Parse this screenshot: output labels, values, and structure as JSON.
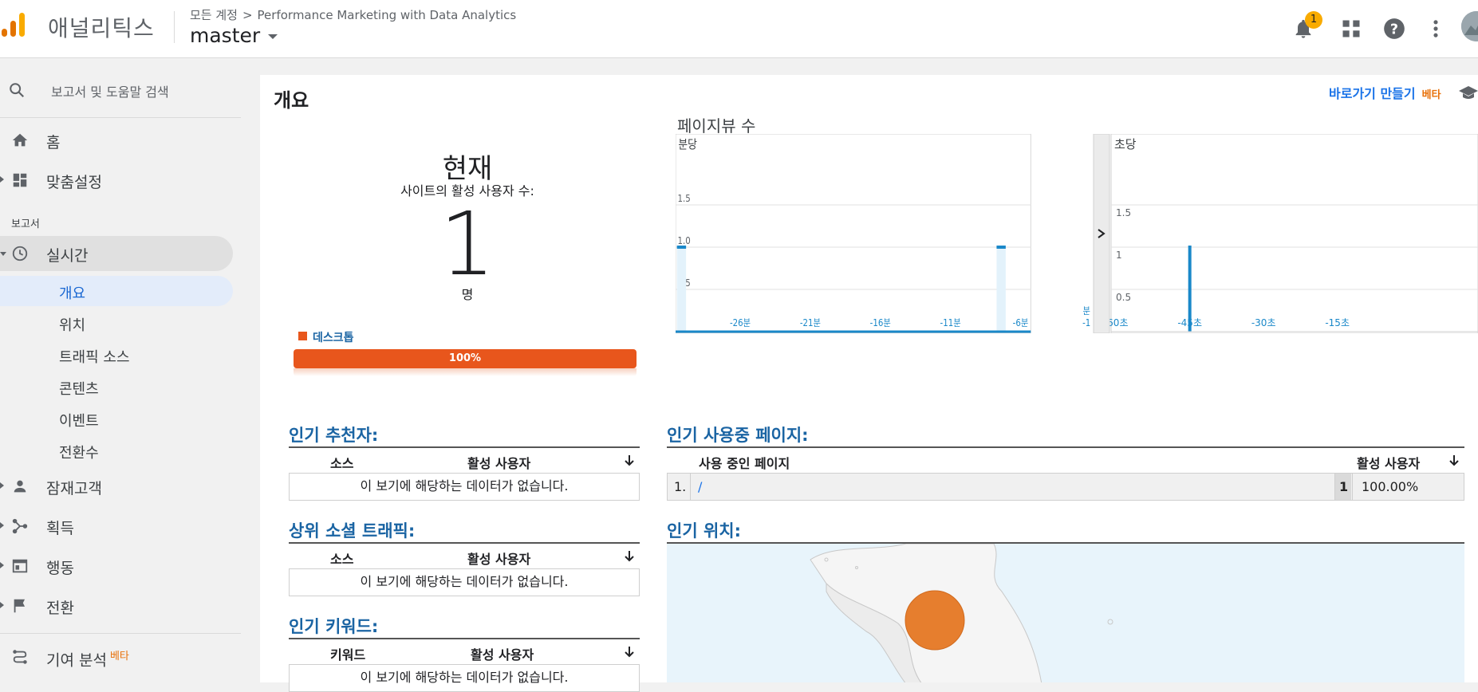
{
  "header": {
    "app_name": "애널리틱스",
    "breadcrumb_root": "모든 계정",
    "breadcrumb_sep": ">",
    "breadcrumb_property": "Performance Marketing with Data Analytics",
    "account_view": "master",
    "notification_count": "1"
  },
  "sidebar": {
    "search_placeholder": "보고서 및 도움말 검색",
    "home": "홈",
    "customization": "맞춤설정",
    "reports_section": "보고서",
    "realtime": "실시간",
    "realtime_sub": {
      "overview": "개요",
      "locations": "위치",
      "traffic_sources": "트래픽 소스",
      "content": "콘텐츠",
      "events": "이벤트",
      "conversions": "전환수"
    },
    "audience": "잠재고객",
    "acquisition": "획득",
    "behavior": "행동",
    "conversions": "전환",
    "attribution": "기여 분석",
    "attribution_badge": "베타"
  },
  "main": {
    "page_title": "개요",
    "shortcut_label": "바로가기 만들기",
    "shortcut_badge": "베타",
    "now_label": "현재",
    "active_users_label": "사이트의 활성 사용자 수:",
    "active_users_count": "1",
    "unit": "명",
    "device_legend": "데스크톱",
    "device_percent": "100%",
    "device_share": 1.0,
    "pageviews_title": "페이지뷰 수"
  },
  "chart_data": {
    "type": "bar",
    "title": "페이지뷰 수",
    "panels": [
      {
        "name": "분당",
        "x": [
          "-30",
          "-29",
          "-28",
          "-27",
          "-26",
          "-25",
          "-24",
          "-23",
          "-22",
          "-21",
          "-20",
          "-19",
          "-18",
          "-17",
          "-16",
          "-15",
          "-14",
          "-13",
          "-12",
          "-11",
          "-10",
          "-9",
          "-8",
          "-7",
          "-6",
          "-5",
          "-4",
          "-3",
          "-2",
          "-1"
        ],
        "values": [
          1,
          0,
          0,
          0,
          0,
          0,
          0,
          0,
          0,
          0,
          0,
          0,
          0,
          0,
          0,
          0,
          0,
          0,
          0,
          0,
          0,
          0,
          0,
          0,
          0,
          0,
          0,
          1,
          0,
          0
        ],
        "tick_labels": [
          "-26분",
          "-21분",
          "-16분",
          "-11분",
          "-6분",
          "분",
          "-1"
        ],
        "y_ticks": [
          "0.5",
          "1.0",
          "1.5"
        ],
        "ylim": [
          0,
          2
        ]
      },
      {
        "name": "초당",
        "x": [
          -60,
          -59,
          -58,
          -57,
          -56,
          -55,
          -54,
          -53,
          -52,
          -51,
          -50,
          -49,
          -48,
          -47,
          -46,
          -45,
          -44,
          -43,
          -42,
          -41,
          -40,
          -39,
          -38,
          -37,
          -36,
          -35,
          -34,
          -33,
          -32,
          -31,
          -30,
          -29,
          -28,
          -27,
          -26,
          -25,
          -24,
          -23,
          -22,
          -21,
          -20,
          -19,
          -18,
          -17,
          -16,
          -15,
          -14,
          -13,
          -12,
          -11,
          -10,
          -9,
          -8,
          -7,
          -6,
          -5,
          -4,
          -3,
          -2,
          -1
        ],
        "values": [
          0,
          0,
          0,
          0,
          0,
          0,
          0,
          0,
          0,
          0,
          0,
          0,
          0,
          0,
          0,
          1,
          0,
          0,
          0,
          0,
          0,
          0,
          0,
          0,
          0,
          0,
          0,
          0,
          0,
          0,
          0,
          0,
          0,
          0,
          0,
          0,
          0,
          0,
          0,
          0,
          0,
          0,
          0,
          0,
          0,
          0,
          0,
          0,
          0,
          0,
          0,
          0,
          0,
          0,
          0,
          0,
          0,
          0,
          0,
          0
        ],
        "tick_labels": [
          "-60초",
          "-45초",
          "-30초",
          "-15초"
        ],
        "y_ticks": [
          "0.5",
          "1",
          "1.5"
        ],
        "ylim": [
          0,
          2
        ]
      }
    ]
  },
  "referrers": {
    "title": "인기 추천자:",
    "col_source": "소스",
    "col_active": "활성 사용자",
    "empty": "이 보기에 해당하는 데이터가 없습니다."
  },
  "social": {
    "title": "상위 소셜 트래픽:",
    "col_source": "소스",
    "col_active": "활성 사용자",
    "empty": "이 보기에 해당하는 데이터가 없습니다."
  },
  "keywords": {
    "title": "인기 키워드:",
    "col_keyword": "키워드",
    "col_active": "활성 사용자",
    "empty": "이 보기에 해당하는 데이터가 없습니다."
  },
  "active_pages": {
    "title": "인기 사용중 페이지:",
    "col_page": "사용 중인 페이지",
    "col_active": "활성 사용자",
    "rows": [
      {
        "rank": "1.",
        "page": "/",
        "count": "1",
        "percent": "100.00%"
      }
    ]
  },
  "locations": {
    "title": "인기 위치:"
  },
  "colors": {
    "accent": "#1a73e8",
    "bar": "#1a88c9",
    "device": "#e8561c",
    "map_bubble": "#e67e2e",
    "beta": "#e8710a"
  }
}
